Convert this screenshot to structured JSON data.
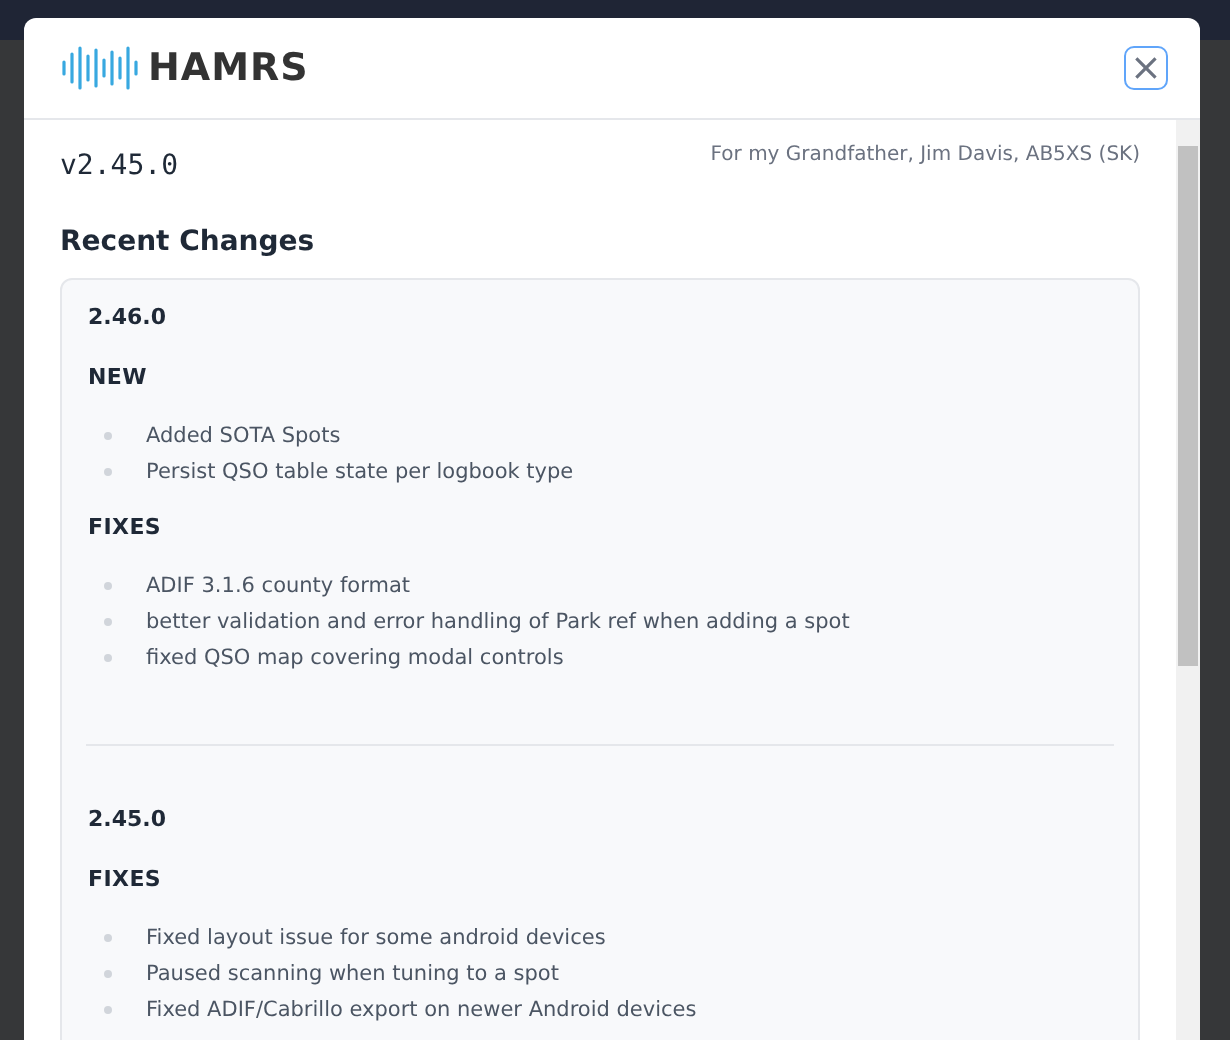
{
  "header": {
    "logo_text": "HAMRS",
    "close_label": "×"
  },
  "version": "v2.45.0",
  "dedication": "For my Grandfather, Jim Davis, AB5XS (SK)",
  "recent_changes": {
    "title": "Recent Changes",
    "releases": [
      {
        "version": "2.46.0",
        "sections": [
          {
            "title": "NEW",
            "items": [
              "Added SOTA Spots",
              "Persist QSO table state per logbook type"
            ]
          },
          {
            "title": "FIXES",
            "items": [
              "ADIF 3.1.6 county format",
              "better validation and error handling of Park ref when adding a spot",
              "fixed QSO map covering modal controls"
            ]
          }
        ]
      },
      {
        "version": "2.45.0",
        "sections": [
          {
            "title": "FIXES",
            "items": [
              "Fixed layout issue for some android devices",
              "Paused scanning when tuning to a spot",
              "Fixed ADIF/Cabrillo export on newer Android devices"
            ]
          }
        ]
      }
    ]
  }
}
